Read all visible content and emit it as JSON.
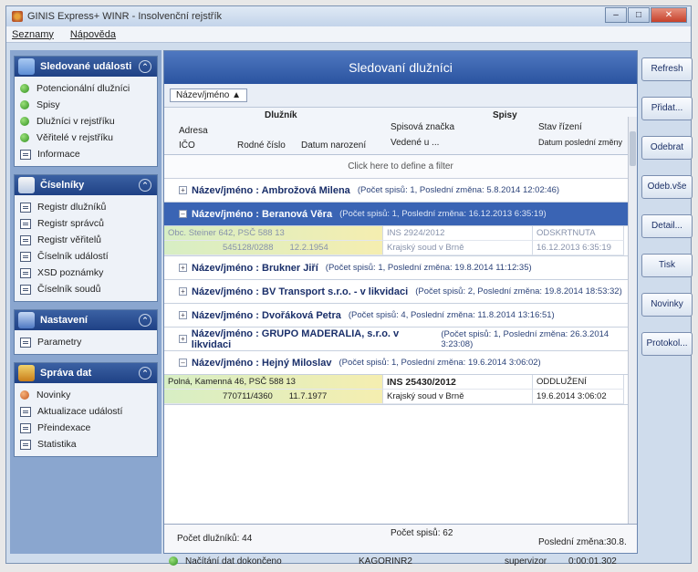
{
  "window": {
    "title": "GINIS Express+ WINR - Insolvenční rejstřík"
  },
  "menu": [
    "Seznamy",
    "Nápověda"
  ],
  "sidebar": {
    "groups": [
      {
        "title": "Sledované události",
        "items": [
          {
            "label": "Potencionální dlužníci",
            "icon": "green-dot"
          },
          {
            "label": "Spisy",
            "icon": "green-dot"
          },
          {
            "label": "Dlužníci v rejstříku",
            "icon": "green-dot"
          },
          {
            "label": "Věřitelé v rejstříku",
            "icon": "green-dot"
          },
          {
            "label": "Informace",
            "icon": "doc"
          }
        ]
      },
      {
        "title": "Číselníky",
        "items": [
          {
            "label": "Registr dlužníků",
            "icon": "doc"
          },
          {
            "label": "Registr správců",
            "icon": "doc"
          },
          {
            "label": "Registr věřitelů",
            "icon": "doc"
          },
          {
            "label": "Číselník událostí",
            "icon": "doc"
          },
          {
            "label": "XSD poznámky",
            "icon": "doc"
          },
          {
            "label": "Číselník soudů",
            "icon": "doc"
          }
        ]
      },
      {
        "title": "Nastavení",
        "items": [
          {
            "label": "Parametry",
            "icon": "doc"
          }
        ]
      },
      {
        "title": "Správa dat",
        "items": [
          {
            "label": "Novinky",
            "icon": "green-dot"
          },
          {
            "label": "Aktualizace událostí",
            "icon": "doc"
          },
          {
            "label": "Přeindexace",
            "icon": "doc"
          },
          {
            "label": "Statistika",
            "icon": "doc"
          }
        ]
      }
    ]
  },
  "main": {
    "title": "Sledovaní dlužníci",
    "groupby_chip": "Název/jméno",
    "columns": {
      "dluznik": "Dlužník",
      "spisy": "Spisy",
      "adresa": "Adresa",
      "ico": "IČO",
      "rodne_cislo": "Rodné číslo",
      "datum_narozeni": "Datum narození",
      "spisova_znacka": "Spisová značka",
      "vedene_u": "Vedené u ...",
      "stav_rizeni": "Stav řízení",
      "datum_posledni_zmeny": "Datum poslední změny"
    },
    "filter_text": "Click here to define a filter",
    "groups": [
      {
        "name": "Název/jméno : Ambrožová Milena",
        "info": "(Počet spisů: 1, Poslední změna: 5.8.2014 12:02:46)"
      },
      {
        "name": "Název/jméno : Beranová Věra",
        "info": "(Počet spisů: 1, Poslední změna: 16.12.2013 6:35:19)"
      },
      {
        "name": "Název/jméno : Brukner Jiří",
        "info": "(Počet spisů: 1, Poslední změna: 19.8.2014 11:12:35)"
      },
      {
        "name": "Název/jméno : BV Transport s.r.o. - v likvidaci",
        "info": "(Počet spisů: 2, Poslední změna: 19.8.2014 18:53:32)"
      },
      {
        "name": "Název/jméno : Dvořáková Petra",
        "info": "(Počet spisů: 4, Poslední změna: 11.8.2014 13:16:51)"
      },
      {
        "name": "Název/jméno : GRUPO MADERALIA, s.r.o. v likvidaci",
        "info": "(Počet spisů: 1, Poslední změna: 26.3.2014 3:23:08)"
      },
      {
        "name": "Název/jméno : Hejný Miloslav",
        "info": "(Počet spisů: 1, Poslední změna: 19.6.2014 3:06:02)"
      }
    ],
    "detail_beranova": {
      "adresa": "Obc. Steiner 642, PSČ 588 13",
      "rodne_cislo": "545128/0288",
      "datum_narozeni": "12.2.1954",
      "spis": "INS 2924/2012",
      "soud": "Krajský soud v Brně",
      "stav": "ODSKRTNUTA",
      "datum": "16.12.2013 6:35:19"
    },
    "detail_hejny": {
      "adresa": "Polná, Kamenná 46, PSČ 588 13",
      "rodne_cislo": "770711/4360",
      "datum_narozeni": "11.7.1977",
      "spis": "INS 25430/2012",
      "soud": "Krajský soud v Brně",
      "stav": "ODDLUŽENÍ",
      "datum": "19.6.2014 3:06:02"
    },
    "footer": {
      "pocet_dluzniku": "Počet dlužníků: 44",
      "pocet_spisu": "Počet spisů: 62",
      "posledni_zmena": "Poslední změna:30.8."
    }
  },
  "buttons": [
    "Refresh",
    "Přidat...",
    "Odebrat",
    "Odeb.vše",
    "Detail...",
    "Tisk",
    "Novinky",
    "Protokol..."
  ],
  "status": {
    "left": "Načítání dat dokončeno",
    "center": "KAGORINR2",
    "user": "supervizor",
    "time": "0:00:01.302"
  }
}
